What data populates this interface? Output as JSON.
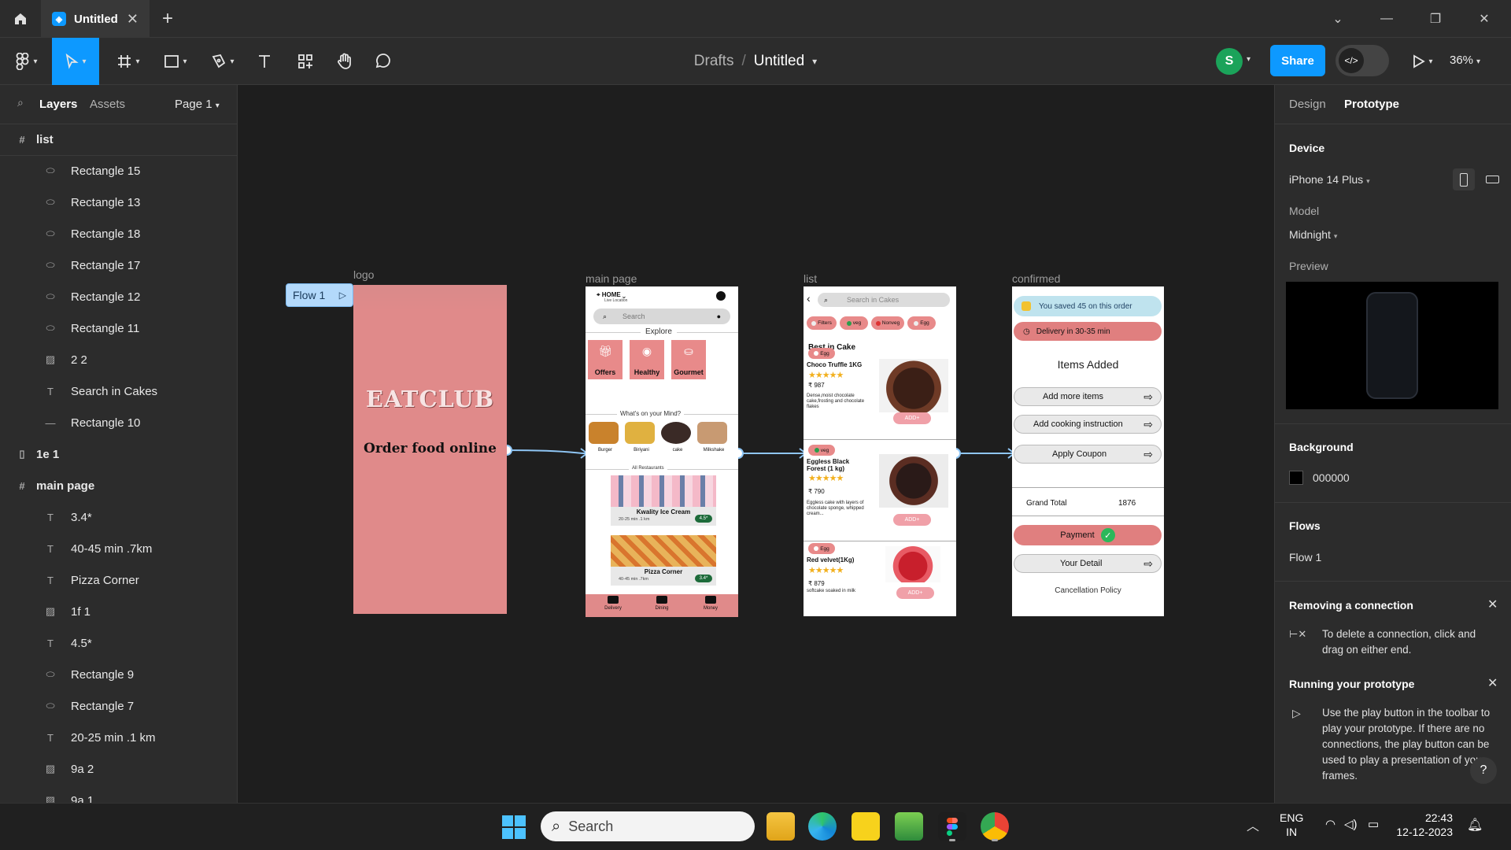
{
  "titlebar": {
    "tab_title": "Untitled",
    "close_glyph": "✕",
    "plus": "+",
    "win_min": "—",
    "win_max": "❐",
    "win_close": "✕",
    "chevron": "⌄"
  },
  "toolbar": {
    "breadcrumb_root": "Drafts",
    "breadcrumb_sep": "/",
    "file_name": "Untitled",
    "avatar_letter": "S",
    "share_label": "Share",
    "zoom": "36%"
  },
  "left_panel": {
    "tabs": [
      "Layers",
      "Assets"
    ],
    "page": "Page 1",
    "layers": [
      {
        "name": "list",
        "icon": "frame-icon",
        "level": 0
      },
      {
        "name": "Rectangle 15",
        "icon": "rect-icon",
        "level": 1
      },
      {
        "name": "Rectangle 13",
        "icon": "rect-icon",
        "level": 1
      },
      {
        "name": "Rectangle 18",
        "icon": "rect-icon",
        "level": 1
      },
      {
        "name": "Rectangle 17",
        "icon": "rect-icon",
        "level": 1
      },
      {
        "name": "Rectangle 12",
        "icon": "rect-icon",
        "level": 1
      },
      {
        "name": "Rectangle 11",
        "icon": "rect-icon",
        "level": 1
      },
      {
        "name": "2 2",
        "icon": "image-icon",
        "level": 1
      },
      {
        "name": "Search in Cakes",
        "icon": "text-icon",
        "level": 1
      },
      {
        "name": "Rectangle 10",
        "icon": "line-icon",
        "level": 1
      },
      {
        "name": "1e 1",
        "icon": "phone-icon",
        "level": 0
      },
      {
        "name": "main page",
        "icon": "frame-icon",
        "level": 0
      },
      {
        "name": "3.4*",
        "icon": "text-icon",
        "level": 1
      },
      {
        "name": "40-45 min .7km",
        "icon": "text-icon",
        "level": 1
      },
      {
        "name": "Pizza Corner",
        "icon": "text-icon",
        "level": 1
      },
      {
        "name": "1f 1",
        "icon": "image-icon",
        "level": 1
      },
      {
        "name": "4.5*",
        "icon": "text-icon",
        "level": 1
      },
      {
        "name": "Rectangle 9",
        "icon": "rect-icon",
        "level": 1
      },
      {
        "name": "Rectangle 7",
        "icon": "rect-icon",
        "level": 1
      },
      {
        "name": "20-25 min .1 km",
        "icon": "text-icon",
        "level": 1
      },
      {
        "name": "9a 2",
        "icon": "image-icon",
        "level": 1
      },
      {
        "name": "9a 1",
        "icon": "image-icon",
        "level": 1
      }
    ]
  },
  "canvas": {
    "flow_label": "Flow 1",
    "frames": {
      "logo": {
        "label": "logo",
        "brand": "EATCLUB",
        "tagline": "Order food online"
      },
      "main": {
        "label": "main page",
        "location": "HOME",
        "location_sub": "Live Location",
        "search": "Search",
        "explore": "Explore",
        "categories": [
          "Offers",
          "Healthy",
          "Gourmet"
        ],
        "mind_title": "What's on your Mind?",
        "foods": [
          "Burger",
          "Biriyani",
          "cake",
          "Milkshake"
        ],
        "all_restaurants": "All Restaurants",
        "restaurants": [
          {
            "name": "Kwality Ice Cream",
            "meta": "20-25 min .1 km",
            "rating": "4.5*"
          },
          {
            "name": "Pizza Corner",
            "meta": "40-45 min .7km",
            "rating": "3.4*"
          }
        ],
        "nav": [
          "Delivery",
          "Dining",
          "Money"
        ]
      },
      "list": {
        "label": "list",
        "search": "Search in Cakes",
        "filters": [
          "Filters",
          "veg",
          "Nonveg",
          "Egg"
        ],
        "heading": "Best in Cake",
        "items": [
          {
            "tag": "Egg",
            "name": "Choco Truffle 1KG",
            "price": "₹ 987",
            "desc": "Dense,moist chocolate cake,frosting and chocolate flakes",
            "add": "ADD+"
          },
          {
            "tag": "veg",
            "name": "Eggless Black Forest (1 kg)",
            "price": "₹ 790",
            "desc": "Eggless cake with layers of chocolate sponge, whipped cream...",
            "add": "ADD+"
          },
          {
            "tag": "Egg",
            "name": "Red velvet(1Kg)",
            "price": "₹ 879",
            "desc": "softcake soaked in milk",
            "add": "ADD+"
          }
        ]
      },
      "confirmed": {
        "label": "confirmed",
        "saved": "You saved 45 on this order",
        "delivery": "Delivery in 30-35 min",
        "items_added": "Items Added",
        "actions": [
          "Add more items",
          "Add cooking instruction",
          "Apply Coupon"
        ],
        "grand_total_label": "Grand Total",
        "grand_total": "1876",
        "payment": "Payment",
        "detail": "Your Detail",
        "policy": "Cancellation Policy"
      }
    }
  },
  "right_panel": {
    "tabs": [
      "Design",
      "Prototype"
    ],
    "device_heading": "Device",
    "device": "iPhone 14 Plus",
    "model_label": "Model",
    "model": "Midnight",
    "preview_label": "Preview",
    "background_heading": "Background",
    "background_hex": "000000",
    "flows_heading": "Flows",
    "flow": "Flow 1",
    "tip1_title": "Removing a connection",
    "tip1_body": "To delete a connection, click and drag on either end.",
    "tip2_title": "Running your prototype",
    "tip2_body": "Use the play button in the toolbar to play your prototype. If there are no connections, the play button can be used to play a presentation of your frames.",
    "help": "?"
  },
  "taskbar": {
    "search": "Search",
    "lang1": "ENG",
    "lang2": "IN",
    "time": "22:43",
    "date": "12-12-2023"
  },
  "colors": {
    "accent": "#0d99ff",
    "brand_pink": "#e08a8a",
    "pill_pink": "#e07f7f",
    "saved_blue": "#bfe3ee"
  }
}
